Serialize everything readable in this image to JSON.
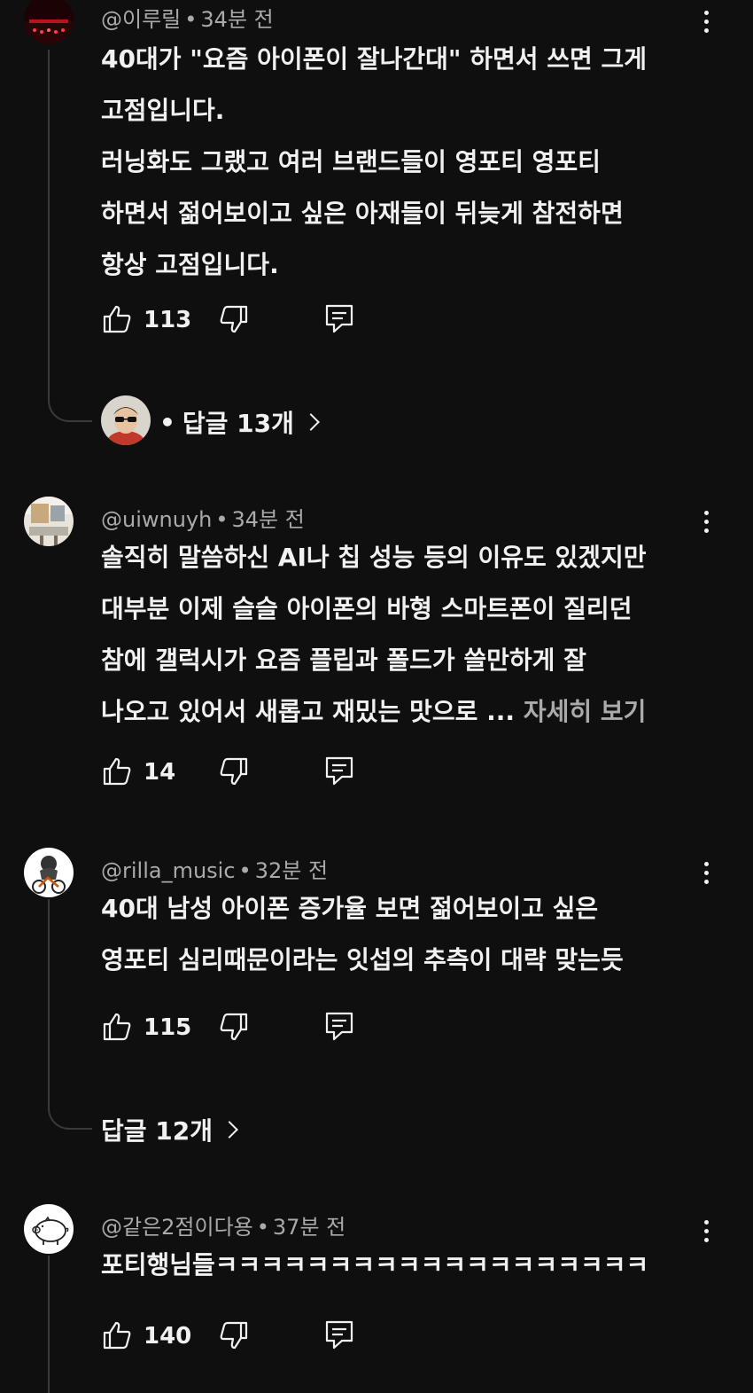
{
  "comments": [
    {
      "handle": "@이루릴",
      "time": "34분 전",
      "lines": [
        "40대가 \"요즘 아이폰이 잘나간대\" 하면서 쓰면 그게",
        "고점입니다.",
        "러닝화도 그랬고 여러 브랜드들이 영포티 영포티",
        "하면서 젊어보이고 싶은 아재들이 뒤늦게 참전하면",
        "항상 고점입니다."
      ],
      "likes": "113",
      "replies_label": "답글 13개"
    },
    {
      "handle": "@uiwnuyh",
      "time": "34분 전",
      "lines": [
        "솔직히 말씀하신 AI나 칩 성능 등의 이유도 있겠지만",
        "대부분 이제 슬슬 아이폰의 바형 스마트폰이 질리던",
        "참에 갤럭시가 요즘 플립과 폴드가 쓸만하게 잘",
        "나오고 있어서 새롭고 재밌는 맛으로 ... "
      ],
      "more_label": "자세히 보기",
      "likes": "14"
    },
    {
      "handle": "@rilla_music",
      "time": "32분 전",
      "lines": [
        "40대 남성 아이폰 증가율 보면 젊어보이고 싶은",
        "영포티 심리때문이라는 잇섭의 추측이 대략 맞는듯"
      ],
      "likes": "115",
      "replies_label": "답글 12개"
    },
    {
      "handle": "@같은2점이다용",
      "time": "37분 전",
      "lines": [
        "포티행님들ㅋㅋㅋㅋㅋㅋㅋㅋㅋㅋㅋㅋㅋㅋㅋㅋㅋㅋㅋ"
      ],
      "likes": "140"
    }
  ],
  "icons": {
    "like": "thumbs-up-icon",
    "dislike": "thumbs-down-icon",
    "reply": "reply-comment-icon",
    "menu": "more-vertical-icon"
  },
  "colors": {
    "background": "#0f0f0f",
    "text": "#f1f1f1",
    "secondary_text": "#aaaaaa"
  }
}
